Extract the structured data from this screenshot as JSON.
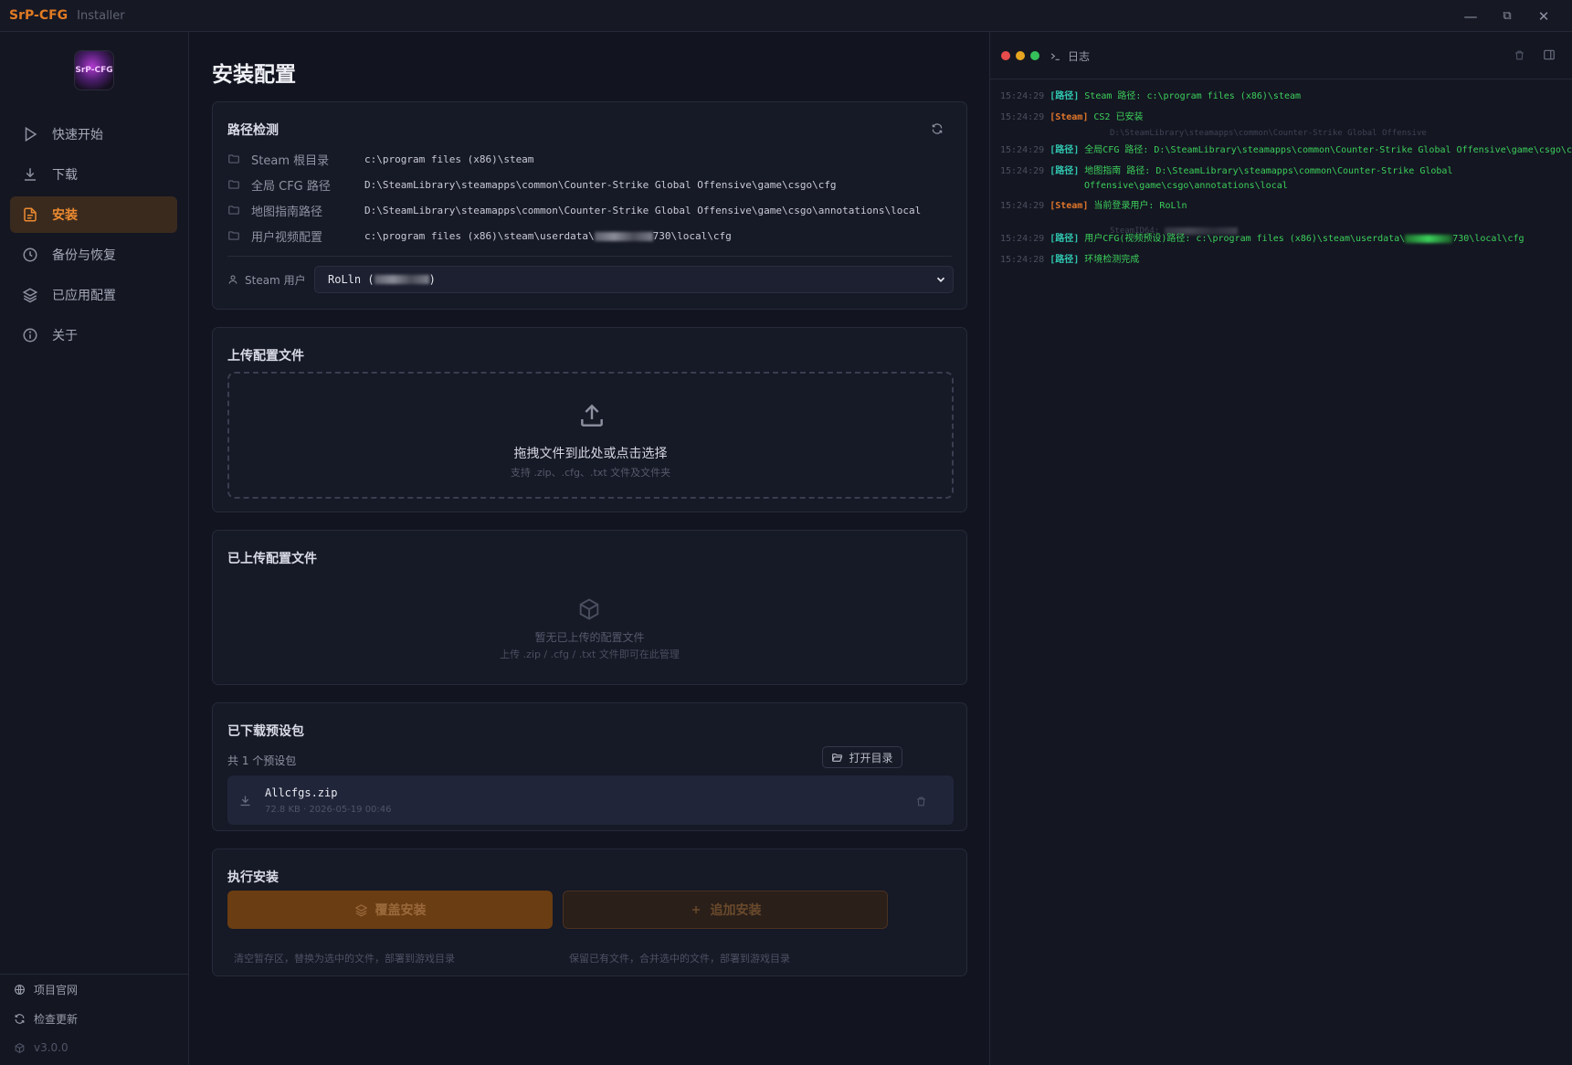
{
  "titlebar": {
    "brand": "SrP-CFG",
    "sub": "Installer",
    "minimize": "—",
    "maximize": "⧉",
    "close": "✕"
  },
  "logo": {
    "text": "SrP-CFG"
  },
  "sidebar": {
    "items": [
      {
        "label": "快速开始",
        "icon": "play-icon"
      },
      {
        "label": "下载",
        "icon": "download-icon"
      },
      {
        "label": "安装",
        "icon": "document-icon",
        "active": true
      },
      {
        "label": "备份与恢复",
        "icon": "clock-icon"
      },
      {
        "label": "已应用配置",
        "icon": "layers-icon"
      },
      {
        "label": "关于",
        "icon": "info-icon"
      }
    ],
    "footer": {
      "website": "项目官网",
      "update": "检查更新",
      "version": "v3.0.0"
    }
  },
  "page": {
    "title": "安装配置"
  },
  "paths": {
    "title": "路径检测",
    "rows": [
      {
        "label": "Steam 根目录",
        "value": "c:\\program files (x86)\\steam"
      },
      {
        "label": "全局 CFG 路径",
        "value": "D:\\SteamLibrary\\steamapps\\common\\Counter-Strike Global Offensive\\game\\csgo\\cfg"
      },
      {
        "label": "地图指南路径",
        "value": "D:\\SteamLibrary\\steamapps\\common\\Counter-Strike Global Offensive\\game\\csgo\\annotations\\local"
      },
      {
        "label": "用户视频配置",
        "value_pre": "c:\\program files (x86)\\steam\\userdata\\",
        "value_post": "730\\local\\cfg"
      }
    ],
    "user_label": "Steam 用户",
    "user_value_pre": "RoLln (",
    "user_value_post": ")"
  },
  "upload": {
    "title": "上传配置文件",
    "drop_main": "拖拽文件到此处或点击选择",
    "drop_sub": "支持 .zip、.cfg、.txt 文件及文件夹"
  },
  "uploaded": {
    "title": "已上传配置文件",
    "empty_main": "暂无已上传的配置文件",
    "empty_sub": "上传 .zip / .cfg / .txt 文件即可在此管理"
  },
  "downloaded": {
    "title": "已下载预设包",
    "count": "共 1 个预设包",
    "open_dir": "打开目录",
    "items": [
      {
        "name": "Allcfgs.zip",
        "meta": "72.8 KB · 2026-05-19 00:46"
      }
    ]
  },
  "install": {
    "title": "执行安装",
    "cover_label": "覆盖安装",
    "add_label": "追加安装",
    "cover_hint": "清空暂存区，替换为选中的文件，部署到游戏目录",
    "add_hint": "保留已有文件，合并选中的文件，部署到游戏目录"
  },
  "log": {
    "title": "日志",
    "lines": [
      {
        "time": "15:24:29",
        "tag": "[路径]",
        "tagtype": "p",
        "text": "Steam 路径: c:\\program files (x86)\\steam"
      },
      {
        "time": "15:24:29",
        "tag": "[Steam]",
        "tagtype": "s",
        "text": "CS2 已安装",
        "sub": "D:\\SteamLibrary\\steamapps\\common\\Counter-Strike Global Offensive"
      },
      {
        "time": "15:24:29",
        "tag": "[路径]",
        "tagtype": "p",
        "text": "全局CFG 路径: D:\\SteamLibrary\\steamapps\\common\\Counter-Strike Global Offensive\\game\\csgo\\cfg"
      },
      {
        "time": "15:24:29",
        "tag": "[路径]",
        "tagtype": "p",
        "text": "地图指南 路径: D:\\SteamLibrary\\steamapps\\common\\Counter-Strike Global",
        "cont": "Offensive\\game\\csgo\\annotations\\local"
      },
      {
        "time": "15:24:29",
        "tag": "[Steam]",
        "tagtype": "s",
        "text": "当前登录用户: RoLln",
        "sub": "SteamID64:"
      },
      {
        "time": "15:24:29",
        "tag": "[路径]",
        "tagtype": "p",
        "text_pre": "用户CFG(视频预设)路径: c:\\program files (x86)\\steam\\userdata\\",
        "text_post": "730\\local\\cfg"
      },
      {
        "time": "15:24:28",
        "tag": "[路径]",
        "tagtype": "p",
        "text": "环境检测完成"
      }
    ]
  },
  "colors": {
    "accent": "#e07a22",
    "bg": "#121420",
    "log_green": "#3cd05a",
    "log_path_tag": "#30c7b0",
    "log_steam_tag": "#e0762a"
  }
}
